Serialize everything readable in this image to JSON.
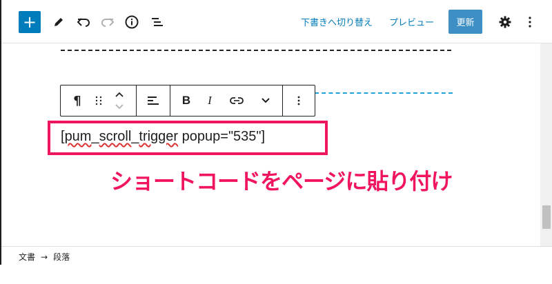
{
  "toolbar": {
    "add_icon": "plus-icon",
    "switch_to_draft": "下書きへ切り替え",
    "preview": "プレビュー",
    "update": "更新",
    "update_color": "#3d8fc5",
    "accent_color": "#007cba"
  },
  "block_toolbar": {
    "paragraph_symbol": "¶",
    "bold": "B",
    "italic": "I"
  },
  "editor": {
    "shortcode_open": "[",
    "shortcode_word1": "pum",
    "shortcode_sep": "_",
    "shortcode_word2": "scroll",
    "shortcode_sep2": "_",
    "shortcode_word3": "trigger",
    "shortcode_rest": " popup=\"535\"]",
    "highlight_color": "#f0155e"
  },
  "annotation": {
    "callout": "ショートコードをページに貼り付け"
  },
  "footer": {
    "breadcrumb_document": "文書",
    "breadcrumb_arrow": "→",
    "breadcrumb_block": "段落"
  }
}
